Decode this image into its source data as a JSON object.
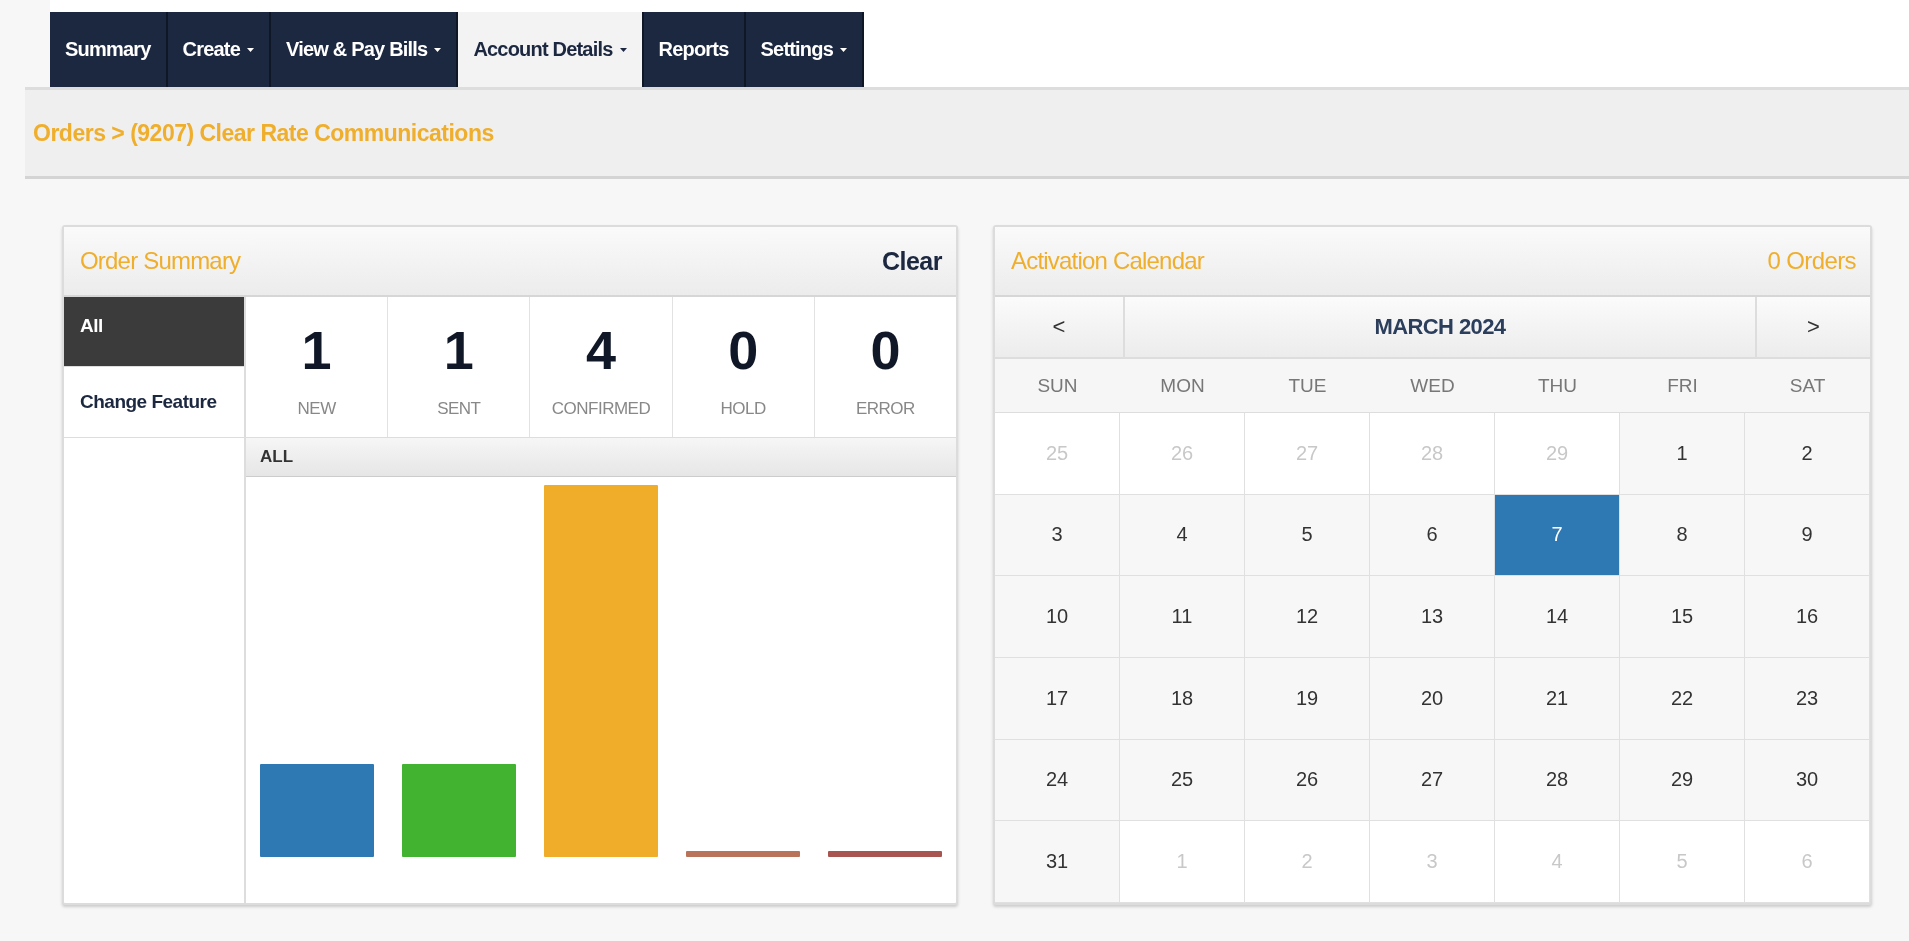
{
  "nav": [
    {
      "label": "Summary",
      "dropdown": false,
      "selected": false
    },
    {
      "label": "Create",
      "dropdown": true,
      "selected": false
    },
    {
      "label": "View & Pay Bills",
      "dropdown": true,
      "selected": false
    },
    {
      "label": "Account Details",
      "dropdown": true,
      "selected": true
    },
    {
      "label": "Reports",
      "dropdown": false,
      "selected": false
    },
    {
      "label": "Settings",
      "dropdown": true,
      "selected": false
    }
  ],
  "breadcrumb": "Orders > (9207) Clear Rate Communications",
  "order_summary": {
    "title": "Order Summary",
    "clear": "Clear",
    "filters": [
      {
        "label": "All",
        "selected": true
      },
      {
        "label": "Change Feature",
        "selected": false
      }
    ],
    "stats": [
      {
        "count": "1",
        "label": "NEW",
        "color": "#2e78b4"
      },
      {
        "count": "1",
        "label": "SENT",
        "color": "#42b331"
      },
      {
        "count": "4",
        "label": "CONFIRMED",
        "color": "#f0ad2a"
      },
      {
        "count": "0",
        "label": "HOLD",
        "color": "#b8735a"
      },
      {
        "count": "0",
        "label": "ERROR",
        "color": "#a85450"
      }
    ],
    "chart_title": "ALL"
  },
  "calendar": {
    "title": "Activation Calendar",
    "orders": "0 Orders",
    "prev": "<",
    "next": ">",
    "month": "MARCH 2024",
    "weekdays": [
      "SUN",
      "MON",
      "TUE",
      "WED",
      "THU",
      "FRI",
      "SAT"
    ],
    "days": [
      {
        "day": "25",
        "outside": true,
        "selected": false
      },
      {
        "day": "26",
        "outside": true,
        "selected": false
      },
      {
        "day": "27",
        "outside": true,
        "selected": false
      },
      {
        "day": "28",
        "outside": true,
        "selected": false
      },
      {
        "day": "29",
        "outside": true,
        "selected": false
      },
      {
        "day": "1",
        "outside": false,
        "selected": false
      },
      {
        "day": "2",
        "outside": false,
        "selected": false
      },
      {
        "day": "3",
        "outside": false,
        "selected": false
      },
      {
        "day": "4",
        "outside": false,
        "selected": false
      },
      {
        "day": "5",
        "outside": false,
        "selected": false
      },
      {
        "day": "6",
        "outside": false,
        "selected": false
      },
      {
        "day": "7",
        "outside": false,
        "selected": true
      },
      {
        "day": "8",
        "outside": false,
        "selected": false
      },
      {
        "day": "9",
        "outside": false,
        "selected": false
      },
      {
        "day": "10",
        "outside": false,
        "selected": false
      },
      {
        "day": "11",
        "outside": false,
        "selected": false
      },
      {
        "day": "12",
        "outside": false,
        "selected": false
      },
      {
        "day": "13",
        "outside": false,
        "selected": false
      },
      {
        "day": "14",
        "outside": false,
        "selected": false
      },
      {
        "day": "15",
        "outside": false,
        "selected": false
      },
      {
        "day": "16",
        "outside": false,
        "selected": false
      },
      {
        "day": "17",
        "outside": false,
        "selected": false
      },
      {
        "day": "18",
        "outside": false,
        "selected": false
      },
      {
        "day": "19",
        "outside": false,
        "selected": false
      },
      {
        "day": "20",
        "outside": false,
        "selected": false
      },
      {
        "day": "21",
        "outside": false,
        "selected": false
      },
      {
        "day": "22",
        "outside": false,
        "selected": false
      },
      {
        "day": "23",
        "outside": false,
        "selected": false
      },
      {
        "day": "24",
        "outside": false,
        "selected": false
      },
      {
        "day": "25",
        "outside": false,
        "selected": false
      },
      {
        "day": "26",
        "outside": false,
        "selected": false
      },
      {
        "day": "27",
        "outside": false,
        "selected": false
      },
      {
        "day": "28",
        "outside": false,
        "selected": false
      },
      {
        "day": "29",
        "outside": false,
        "selected": false
      },
      {
        "day": "30",
        "outside": false,
        "selected": false
      },
      {
        "day": "31",
        "outside": false,
        "selected": false
      },
      {
        "day": "1",
        "outside": true,
        "selected": false
      },
      {
        "day": "2",
        "outside": true,
        "selected": false
      },
      {
        "day": "3",
        "outside": true,
        "selected": false
      },
      {
        "day": "4",
        "outside": true,
        "selected": false
      },
      {
        "day": "5",
        "outside": true,
        "selected": false
      },
      {
        "day": "6",
        "outside": true,
        "selected": false
      }
    ]
  }
}
